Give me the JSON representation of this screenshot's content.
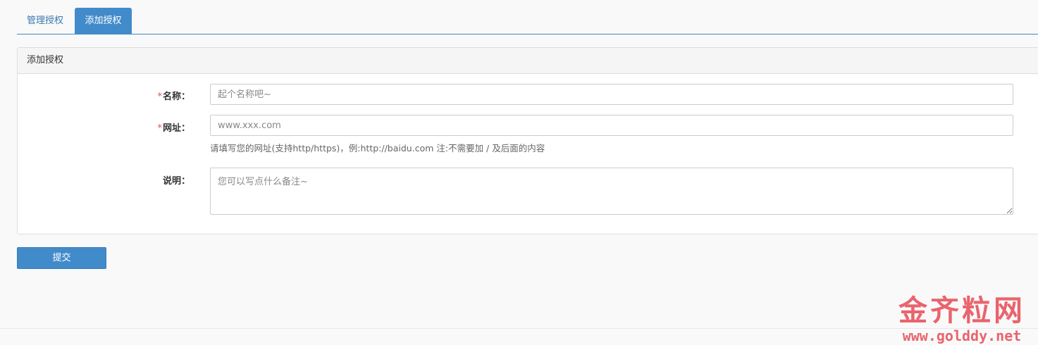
{
  "tabs": [
    {
      "label": "管理授权",
      "active": false
    },
    {
      "label": "添加授权",
      "active": true
    }
  ],
  "panel": {
    "title": "添加授权",
    "fields": {
      "name": {
        "required_mark": "*",
        "label": "名称：",
        "value": "",
        "placeholder": "起个名称吧~"
      },
      "url": {
        "required_mark": "*",
        "label": "网址：",
        "value": "",
        "placeholder": "www.xxx.com",
        "help": "请填写您的网址(支持http/https)，例:http://baidu.com 注:不需要加 / 及后面的内容"
      },
      "description": {
        "label": "说明：",
        "value": "",
        "placeholder": "您可以写点什么备注~"
      }
    }
  },
  "submit_label": "提交",
  "watermark": {
    "cn": "金齐粒网",
    "url": "www.golddy.net"
  },
  "colors": {
    "primary": "#428bca",
    "required": "#d9534f",
    "watermark": "#e9646d"
  }
}
